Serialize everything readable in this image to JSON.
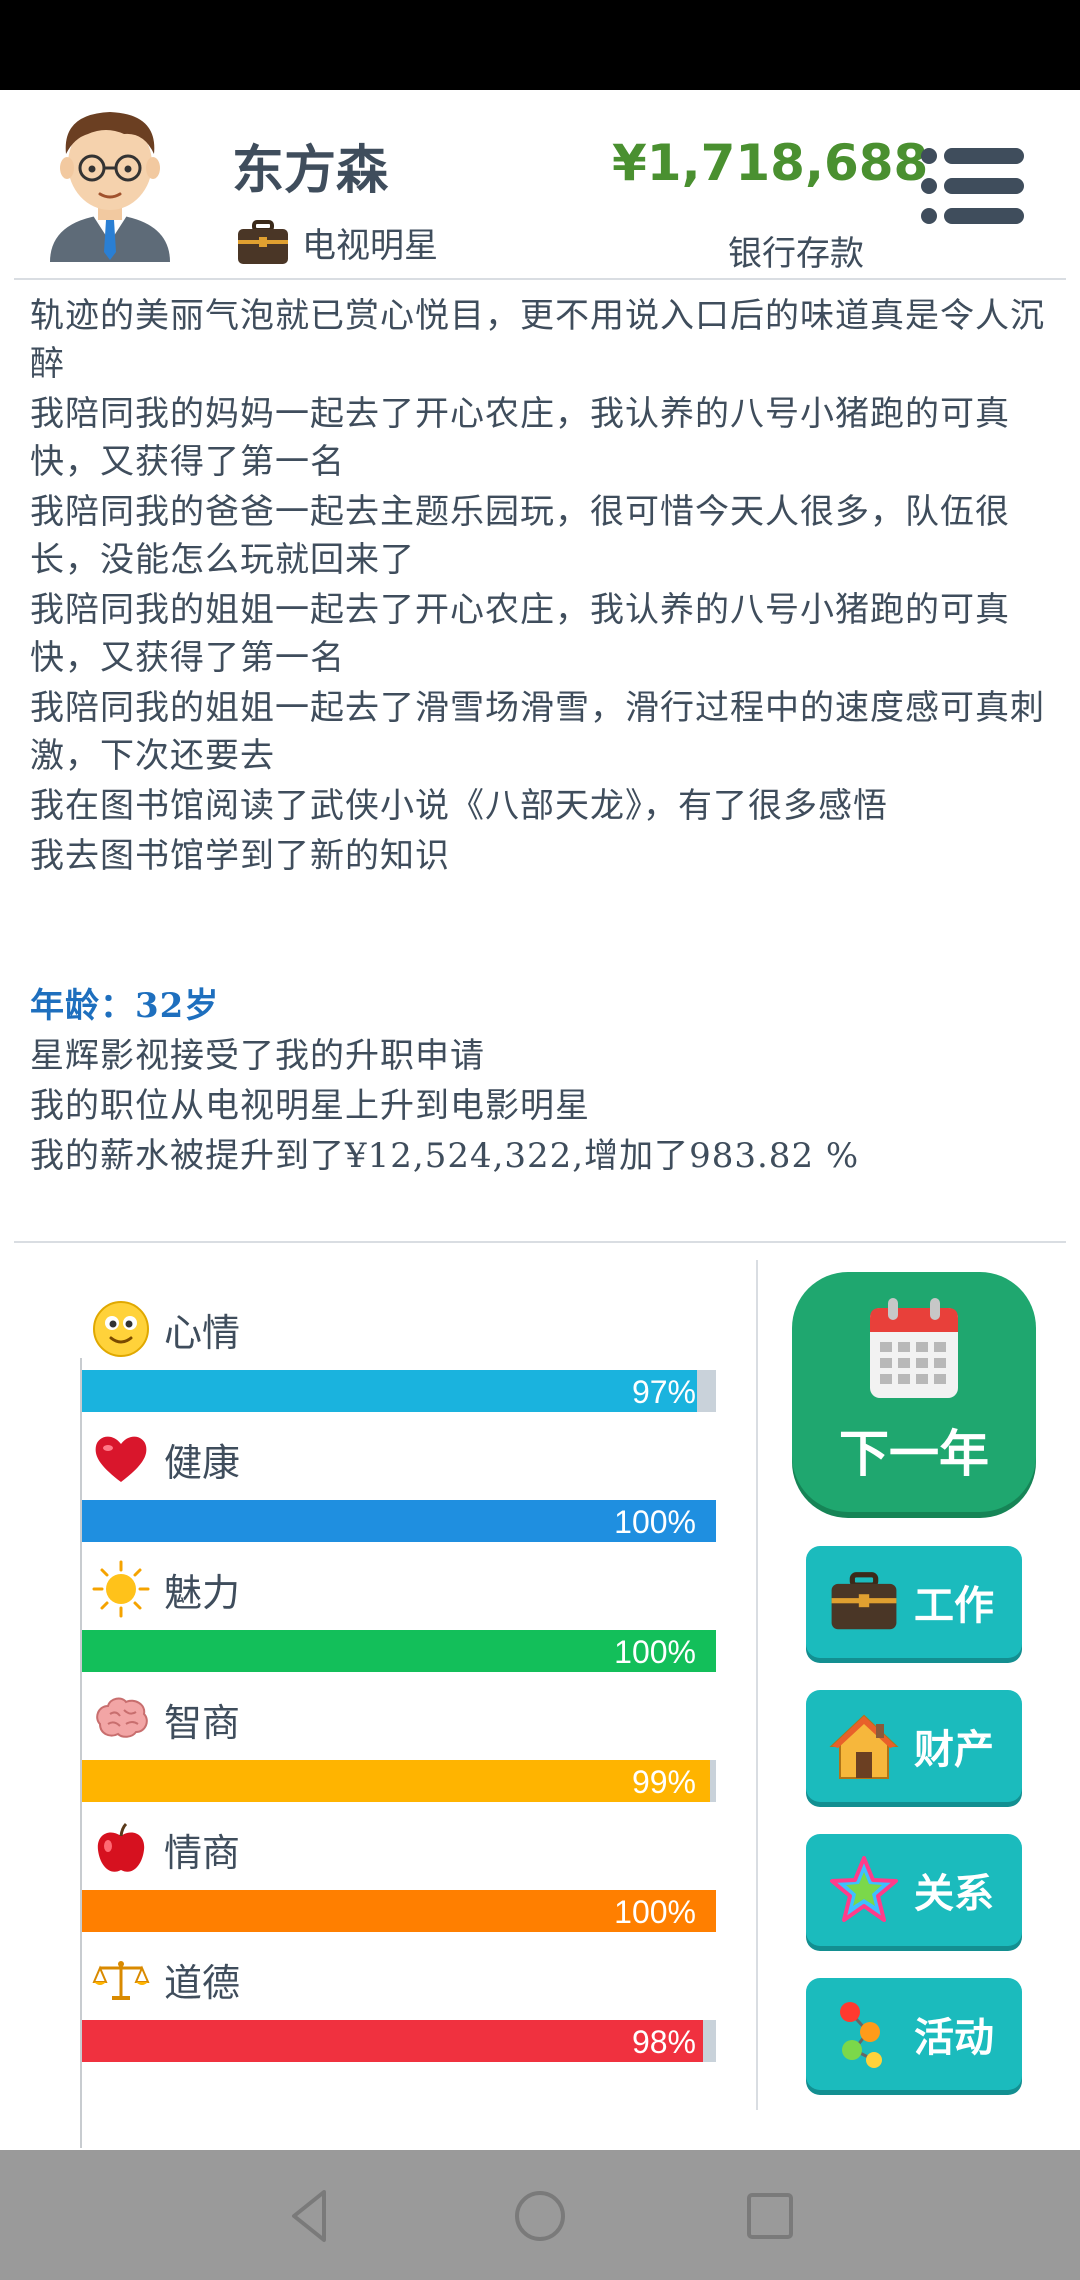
{
  "header": {
    "name": "东方森",
    "job_title": "电视明星",
    "money": "¥1,718,688",
    "bank_label": "银行存款"
  },
  "log": {
    "lines": [
      "轨迹的美丽气泡就已赏心悦目，更不用说入口后的味道真是令人沉醉",
      "我陪同我的妈妈一起去了开心农庄，我认养的八号小猪跑的可真快，又获得了第一名",
      "我陪同我的爸爸一起去主题乐园玩，很可惜今天人很多，队伍很长，没能怎么玩就回来了",
      "我陪同我的姐姐一起去了开心农庄，我认养的八号小猪跑的可真快，又获得了第一名",
      "我陪同我的姐姐一起去了滑雪场滑雪，滑行过程中的速度感可真刺激，下次还要去",
      "我在图书馆阅读了武侠小说《八部天龙》，有了很多感悟",
      "我去图书馆学到了新的知识"
    ],
    "age": "年龄：32岁",
    "events": [
      "星辉影视接受了我的升职申请",
      "我的职位从电视明星上升到电影明星",
      "我的薪水被提升到了¥12,524,322,增加了983.82 %"
    ]
  },
  "stats": [
    {
      "label": "心情",
      "percent_text": "97%",
      "level": 0.97,
      "color": "#1ab3de",
      "icon": "smiley-icon"
    },
    {
      "label": "健康",
      "percent_text": "100%",
      "level": 1.0,
      "color": "#1f8fe0",
      "icon": "heart-icon"
    },
    {
      "label": "魅力",
      "percent_text": "100%",
      "level": 1.0,
      "color": "#13bf5a",
      "icon": "sun-icon"
    },
    {
      "label": "智商",
      "percent_text": "99%",
      "level": 0.99,
      "color": "#ffb400",
      "icon": "brain-icon"
    },
    {
      "label": "情商",
      "percent_text": "100%",
      "level": 1.0,
      "color": "#ff7f00",
      "icon": "apple-icon"
    },
    {
      "label": "道德",
      "percent_text": "98%",
      "level": 0.98,
      "color": "#f0313f",
      "icon": "scales-icon"
    }
  ],
  "actions": {
    "next_year": "下一年",
    "work": "工作",
    "property": "财产",
    "relations": "关系",
    "activities": "活动"
  }
}
